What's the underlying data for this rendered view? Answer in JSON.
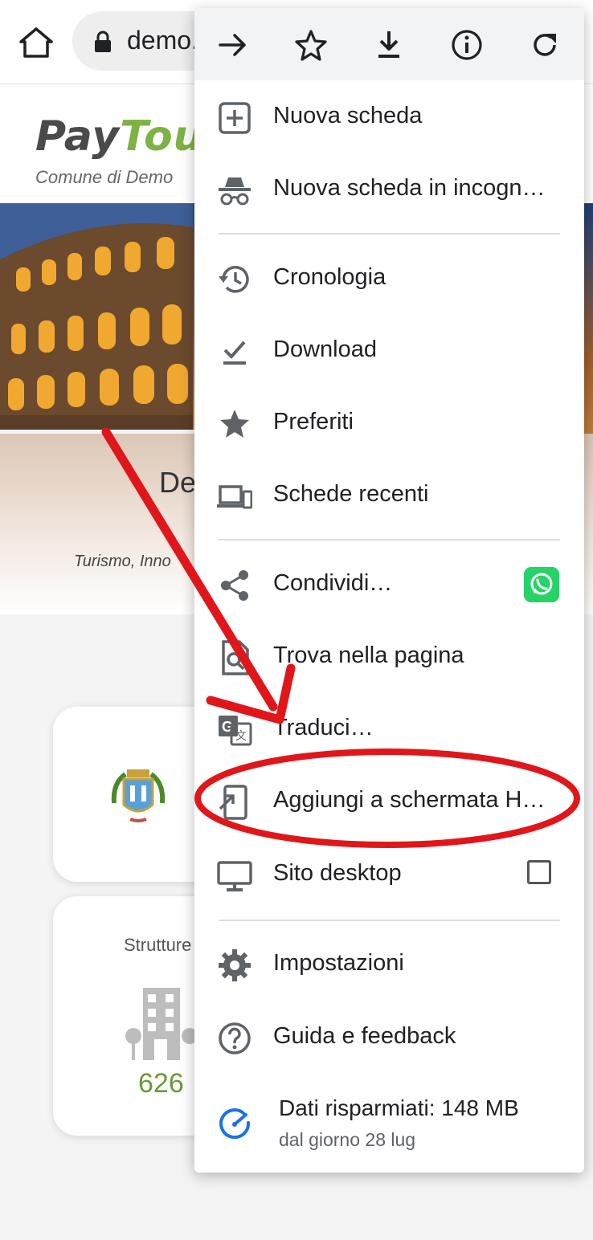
{
  "browser": {
    "url_display": "demo."
  },
  "page": {
    "logo_part1": "PayTou",
    "logo_subtitle": "Comune di Demo",
    "hero_title": "De",
    "hero_subtitle": "Turismo, Inno",
    "card2_label": "Strutture",
    "card2_value": "626"
  },
  "menu": {
    "toolbar_icons": [
      "forward-icon",
      "bookmark-star-icon",
      "download-icon",
      "info-icon",
      "reload-icon"
    ],
    "items": [
      {
        "label": "Nuova scheda",
        "icon": "new-tab-icon"
      },
      {
        "label": "Nuova scheda in incogn…",
        "icon": "incognito-icon"
      },
      {
        "label": "Cronologia",
        "icon": "history-icon"
      },
      {
        "label": "Download",
        "icon": "download-check-icon"
      },
      {
        "label": "Preferiti",
        "icon": "star-icon"
      },
      {
        "label": "Schede recenti",
        "icon": "devices-icon"
      },
      {
        "label": "Condividi…",
        "icon": "share-icon"
      },
      {
        "label": "Trova nella pagina",
        "icon": "find-in-page-icon"
      },
      {
        "label": "Traduci…",
        "icon": "translate-icon"
      },
      {
        "label": "Aggiungi a schermata H…",
        "icon": "add-to-home-icon"
      },
      {
        "label": "Sito desktop",
        "icon": "desktop-icon",
        "checked": false
      },
      {
        "label": "Impostazioni",
        "icon": "gear-icon"
      },
      {
        "label": "Guida e feedback",
        "icon": "help-icon"
      }
    ],
    "data_saver": {
      "title": "Dati risparmiati: 148 MB",
      "subtitle": "dal giorno 28 lug"
    }
  },
  "colors": {
    "annotation_red": "#e0161b",
    "logo_green": "#7cb342",
    "data_saver_blue": "#1a73e8",
    "whatsapp_green": "#25d366"
  }
}
